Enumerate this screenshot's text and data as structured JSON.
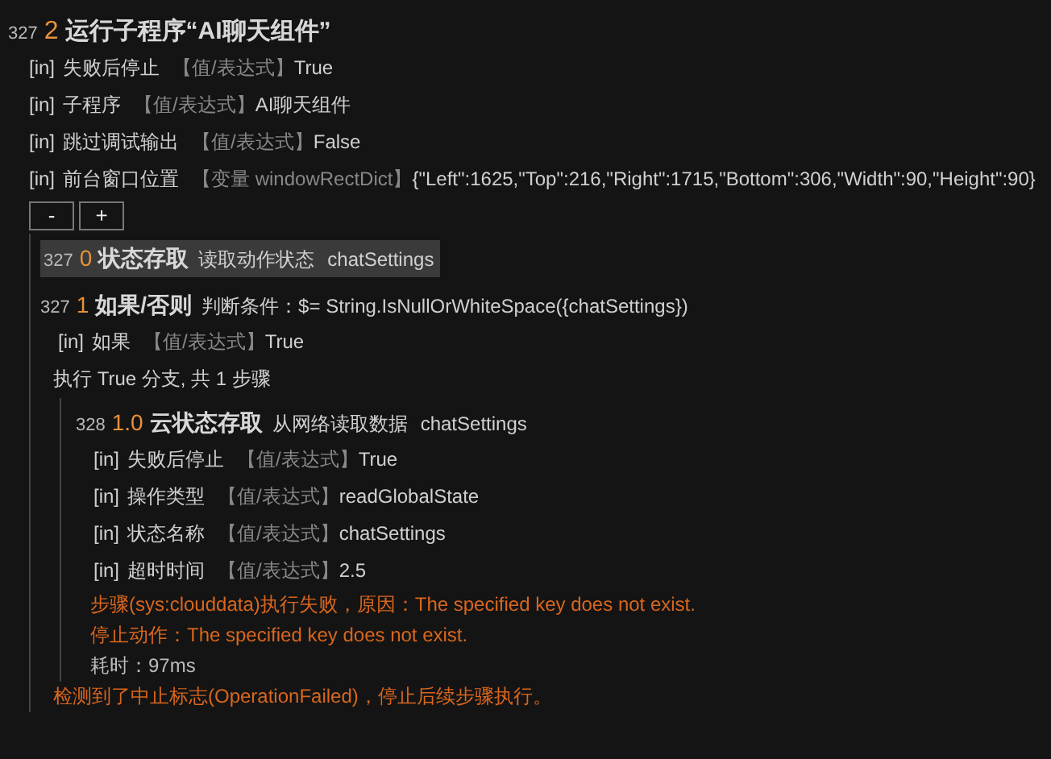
{
  "step": {
    "line": "327",
    "number": "2",
    "title": "运行子程序“AI聊天组件”",
    "params": [
      {
        "tag": "[in]",
        "name": "失败后停止",
        "source": "【值/表达式】",
        "value": "True"
      },
      {
        "tag": "[in]",
        "name": "子程序",
        "source": "【值/表达式】",
        "value": "AI聊天组件"
      },
      {
        "tag": "[in]",
        "name": "跳过调试输出",
        "source": "【值/表达式】",
        "value": "False"
      },
      {
        "tag": "[in]",
        "name": "前台窗口位置",
        "source": "【变量 windowRectDict】",
        "value": "{\"Left\":1625,\"Top\":216,\"Right\":1715,\"Bottom\":306,\"Width\":90,\"Height\":90}"
      }
    ],
    "buttons": [
      "-",
      "+"
    ],
    "children": [
      {
        "line": "327",
        "number": "0",
        "title": "状态存取",
        "desc": "读取动作状态",
        "target": "chatSettings",
        "highlighted": true
      },
      {
        "line": "327",
        "number": "1",
        "title": "如果/否则",
        "desc": "判断条件：$= String.IsNullOrWhiteSpace({chatSettings})",
        "highlighted": false,
        "params": [
          {
            "tag": "[in]",
            "name": "如果",
            "source": "【值/表达式】",
            "value": "True"
          }
        ],
        "summary": "执行 True 分支, 共 1 步骤",
        "children": [
          {
            "line": "328",
            "number": "1.0",
            "title": "云状态存取",
            "desc": "从网络读取数据",
            "target": "chatSettings",
            "highlighted": false,
            "params": [
              {
                "tag": "[in]",
                "name": "失败后停止",
                "source": "【值/表达式】",
                "value": "True"
              },
              {
                "tag": "[in]",
                "name": "操作类型",
                "source": "【值/表达式】",
                "value": "readGlobalState"
              },
              {
                "tag": "[in]",
                "name": "状态名称",
                "source": "【值/表达式】",
                "value": "chatSettings"
              },
              {
                "tag": "[in]",
                "name": "超时时间",
                "source": "【值/表达式】",
                "value": "2.5"
              }
            ],
            "messages": [
              {
                "kind": "error",
                "text": "步骤(sys:clouddata)执行失败，原因：The specified key does not exist."
              },
              {
                "kind": "error",
                "text": "停止动作：The specified key does not exist."
              },
              {
                "kind": "info",
                "text": "耗时：97ms"
              }
            ]
          }
        ],
        "messages": [
          {
            "kind": "error",
            "text": "检测到了中止标志(OperationFailed)，停止后续步骤执行。"
          }
        ]
      }
    ]
  }
}
